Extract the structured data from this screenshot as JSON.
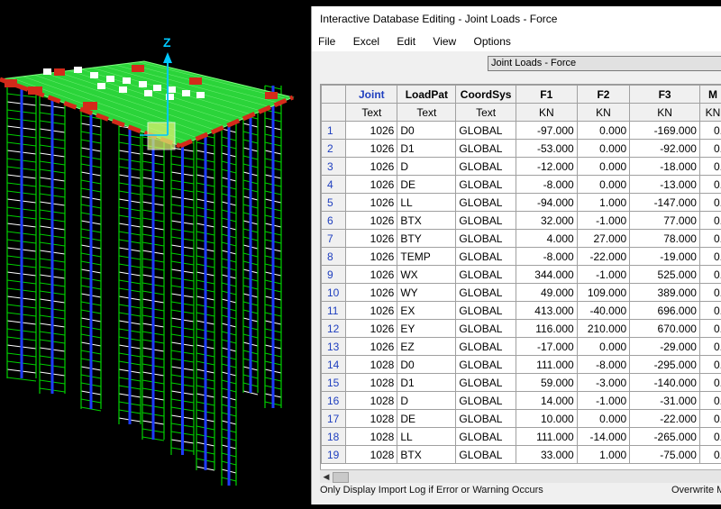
{
  "window": {
    "title": "Interactive Database Editing - Joint Loads - Force"
  },
  "menu": [
    "File",
    "Excel",
    "Edit",
    "View",
    "Options"
  ],
  "table_selector": {
    "value": "Joint Loads - Force"
  },
  "axis_label": "Z",
  "grid": {
    "columns": [
      "Joint",
      "LoadPat",
      "CoordSys",
      "F1",
      "F2",
      "F3",
      "M"
    ],
    "units": [
      "Text",
      "Text",
      "Text",
      "KN",
      "KN",
      "KN",
      "KN"
    ],
    "rows": [
      [
        "1",
        "1026",
        "D0",
        "GLOBAL",
        "-97.000",
        "0.000",
        "-169.000",
        "0."
      ],
      [
        "2",
        "1026",
        "D1",
        "GLOBAL",
        "-53.000",
        "0.000",
        "-92.000",
        "0."
      ],
      [
        "3",
        "1026",
        "D",
        "GLOBAL",
        "-12.000",
        "0.000",
        "-18.000",
        "0."
      ],
      [
        "4",
        "1026",
        "DE",
        "GLOBAL",
        "-8.000",
        "0.000",
        "-13.000",
        "0."
      ],
      [
        "5",
        "1026",
        "LL",
        "GLOBAL",
        "-94.000",
        "1.000",
        "-147.000",
        "0."
      ],
      [
        "6",
        "1026",
        "BTX",
        "GLOBAL",
        "32.000",
        "-1.000",
        "77.000",
        "0."
      ],
      [
        "7",
        "1026",
        "BTY",
        "GLOBAL",
        "4.000",
        "27.000",
        "78.000",
        "0."
      ],
      [
        "8",
        "1026",
        "TEMP",
        "GLOBAL",
        "-8.000",
        "-22.000",
        "-19.000",
        "0."
      ],
      [
        "9",
        "1026",
        "WX",
        "GLOBAL",
        "344.000",
        "-1.000",
        "525.000",
        "0."
      ],
      [
        "10",
        "1026",
        "WY",
        "GLOBAL",
        "49.000",
        "109.000",
        "389.000",
        "0."
      ],
      [
        "11",
        "1026",
        "EX",
        "GLOBAL",
        "413.000",
        "-40.000",
        "696.000",
        "0."
      ],
      [
        "12",
        "1026",
        "EY",
        "GLOBAL",
        "116.000",
        "210.000",
        "670.000",
        "0."
      ],
      [
        "13",
        "1026",
        "EZ",
        "GLOBAL",
        "-17.000",
        "0.000",
        "-29.000",
        "0."
      ],
      [
        "14",
        "1028",
        "D0",
        "GLOBAL",
        "111.000",
        "-8.000",
        "-295.000",
        "0."
      ],
      [
        "15",
        "1028",
        "D1",
        "GLOBAL",
        "59.000",
        "-3.000",
        "-140.000",
        "0."
      ],
      [
        "16",
        "1028",
        "D",
        "GLOBAL",
        "14.000",
        "-1.000",
        "-31.000",
        "0."
      ],
      [
        "17",
        "1028",
        "DE",
        "GLOBAL",
        "10.000",
        "0.000",
        "-22.000",
        "0."
      ],
      [
        "18",
        "1028",
        "LL",
        "GLOBAL",
        "111.000",
        "-14.000",
        "-265.000",
        "0."
      ],
      [
        "19",
        "1028",
        "BTX",
        "GLOBAL",
        "33.000",
        "1.000",
        "-75.000",
        "0."
      ]
    ]
  },
  "status": {
    "left": "Only Display Import Log if Error or Warning Occurs",
    "right": "Overwrite M"
  },
  "colors": {
    "model_bg": "#000000",
    "frame_green": "#00d000",
    "frame_blue": "#1e3cff",
    "slab": "#2bd43a",
    "load_red": "#d42a1a",
    "joint_blue": "#1f3fbf"
  }
}
